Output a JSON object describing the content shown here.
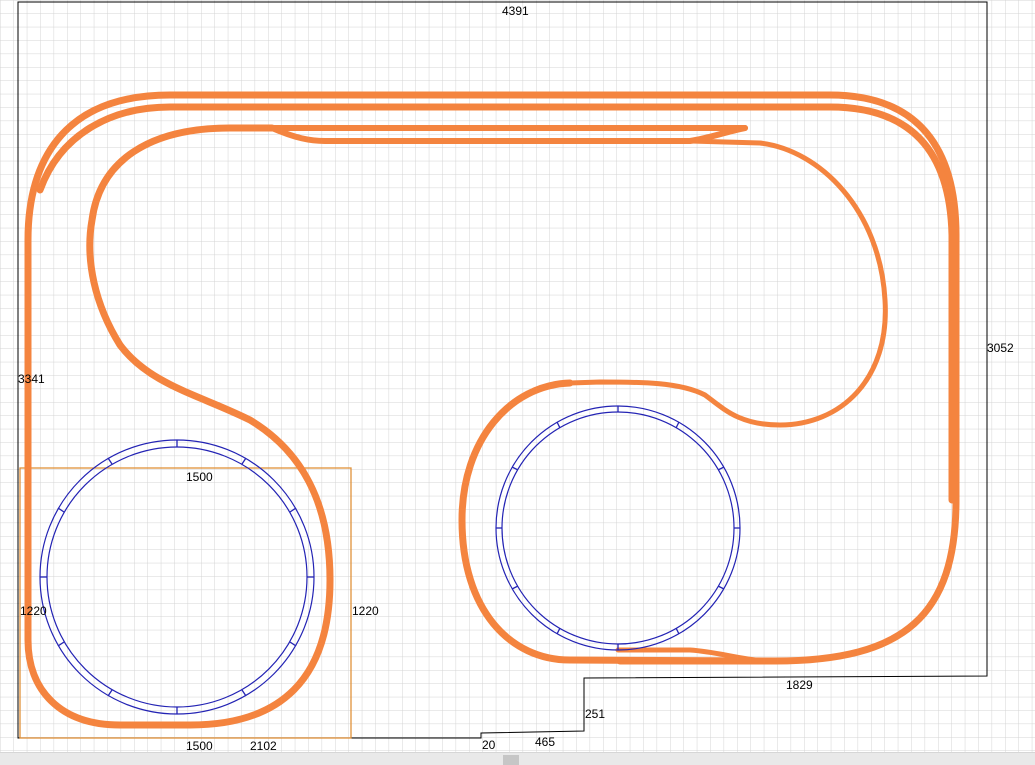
{
  "colors": {
    "grid": "#d4d4d4",
    "outline": "#000000",
    "track": "#f4843f",
    "turntable": "#2323b4",
    "baseboard": "#e0913a"
  },
  "dimensions": {
    "top_width": "4391",
    "right_height": "3052",
    "left_height": "3341",
    "box_left": "1220",
    "box_right": "1220",
    "left_circle_top": "1500",
    "left_circle_bottom": "1500",
    "bottom_left_width": "2102",
    "notch_small": "20",
    "notch_width": "465",
    "notch_height": "251",
    "bottom_right_width": "1829"
  },
  "icons": {
    "turntable_left": "turntable-icon",
    "turntable_right": "turntable-icon"
  }
}
